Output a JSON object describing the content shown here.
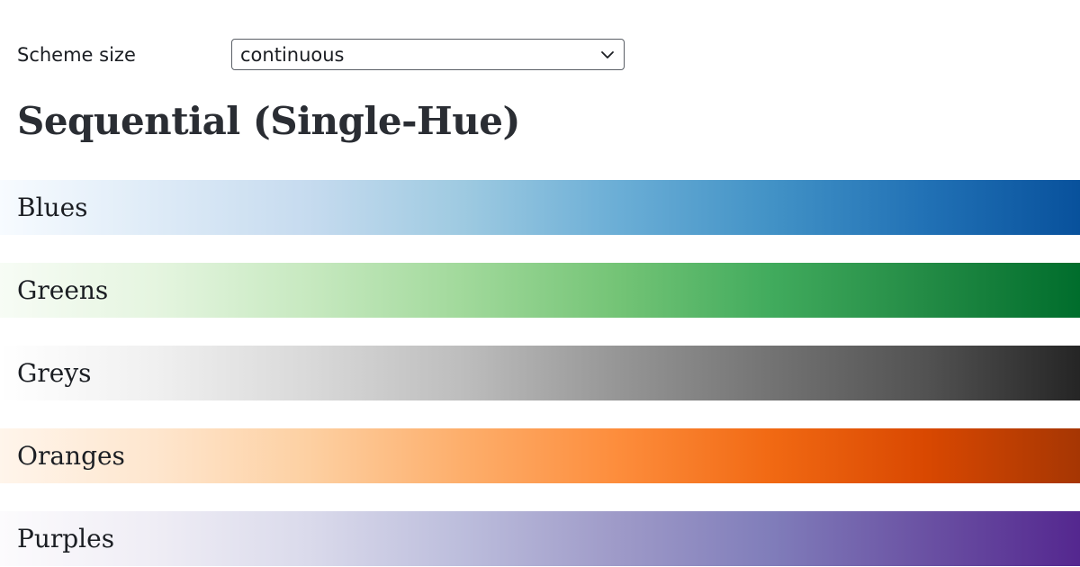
{
  "controls": {
    "scheme_size_label": "Scheme size",
    "scheme_size_value": "continuous",
    "chevron_icon": "chevron-down-icon"
  },
  "section": {
    "title": "Sequential (Single-Hue)"
  },
  "schemes": [
    {
      "name": "Blues",
      "colors": [
        "#f7fbff",
        "#deebf7",
        "#c6dbef",
        "#9ecae1",
        "#6baed6",
        "#4292c6",
        "#2171b5",
        "#08519c"
      ]
    },
    {
      "name": "Greens",
      "colors": [
        "#f7fcf5",
        "#e5f5e0",
        "#c7e9c0",
        "#a1d99b",
        "#74c476",
        "#41ab5d",
        "#238b45",
        "#006d2c"
      ]
    },
    {
      "name": "Greys",
      "colors": [
        "#ffffff",
        "#f0f0f0",
        "#d9d9d9",
        "#bdbdbd",
        "#969696",
        "#737373",
        "#525252",
        "#252525"
      ]
    },
    {
      "name": "Oranges",
      "colors": [
        "#fff5eb",
        "#fee6ce",
        "#fdd0a2",
        "#fdae6b",
        "#fd8d3c",
        "#f16913",
        "#d94801",
        "#a63603"
      ]
    },
    {
      "name": "Purples",
      "colors": [
        "#fcfbfd",
        "#efedf5",
        "#dadaeb",
        "#bcbddc",
        "#9e9ac8",
        "#807dba",
        "#6a51a3",
        "#54278f"
      ]
    }
  ]
}
